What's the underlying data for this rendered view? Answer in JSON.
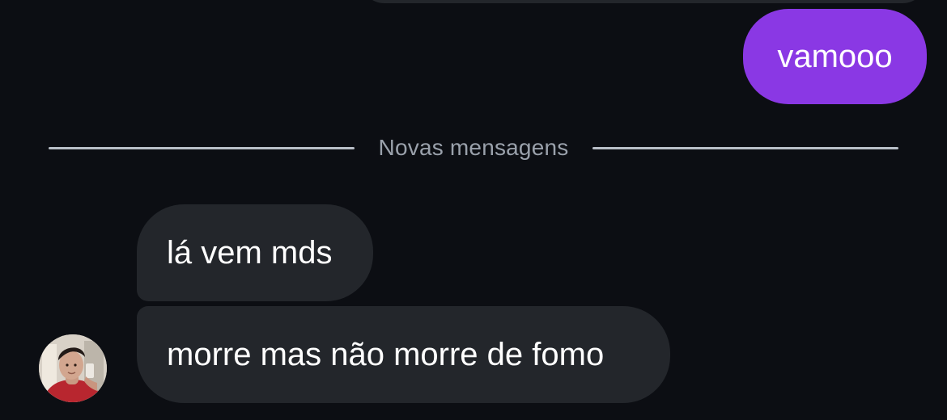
{
  "chat": {
    "outgoing_message": "vamooo",
    "divider_label": "Novas mensagens",
    "incoming_messages": [
      "lá vem mds",
      "morre mas não morre de fomo"
    ]
  },
  "theme": {
    "background": "#0c0e13",
    "outgoing_bubble": "#8a38e4",
    "incoming_bubble": "#23262b",
    "divider_line": "#b9bfc8",
    "divider_text": "#9aa1ab"
  },
  "icons": {
    "avatar": "contact-avatar"
  }
}
